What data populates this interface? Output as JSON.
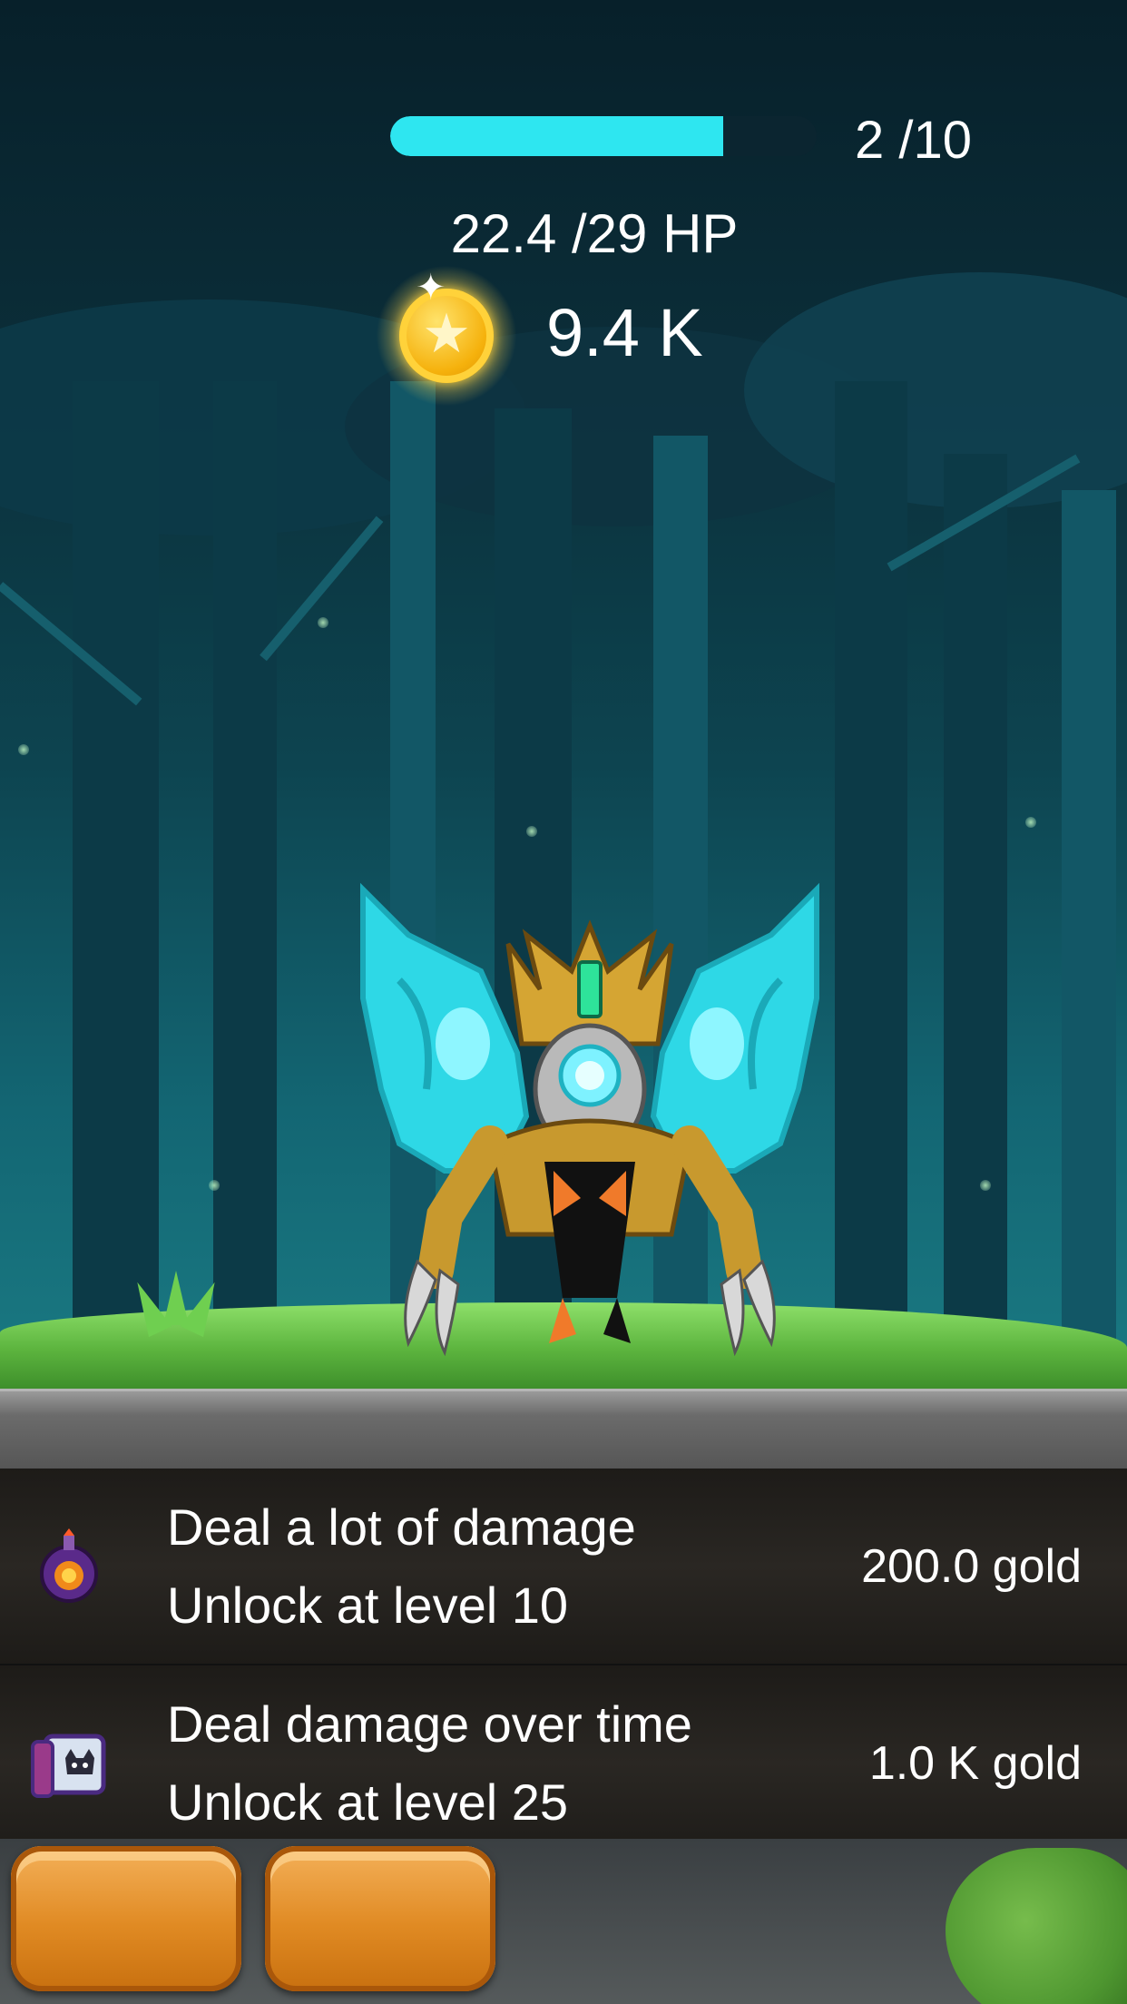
{
  "hud": {
    "stage_progress": {
      "current": 2,
      "total": 10,
      "label": "2 /10",
      "fill_fraction": 0.78
    },
    "hp_label": "22.4 /29 HP",
    "gold_label": "9.4 K",
    "coin_icon": "gold-coin-star-icon"
  },
  "enemy": {
    "icon": "winged-armored-boss-creature"
  },
  "upgrades": [
    {
      "icon": "fire-bomb-potion-icon",
      "title": "Deal a lot of damage",
      "unlock": "Unlock at level 10",
      "cost": "200.0 gold"
    },
    {
      "icon": "cat-scroll-spellbook-icon",
      "title": "Deal damage over time",
      "unlock": "Unlock at level 25",
      "cost": "1.0 K gold"
    }
  ],
  "footer": {
    "buttons": [
      {
        "label": ""
      },
      {
        "label": ""
      }
    ]
  },
  "colors": {
    "progress_fill": "#2ee6f0",
    "button_orange": "#e08a23",
    "panel_dark": "#2a2723"
  }
}
